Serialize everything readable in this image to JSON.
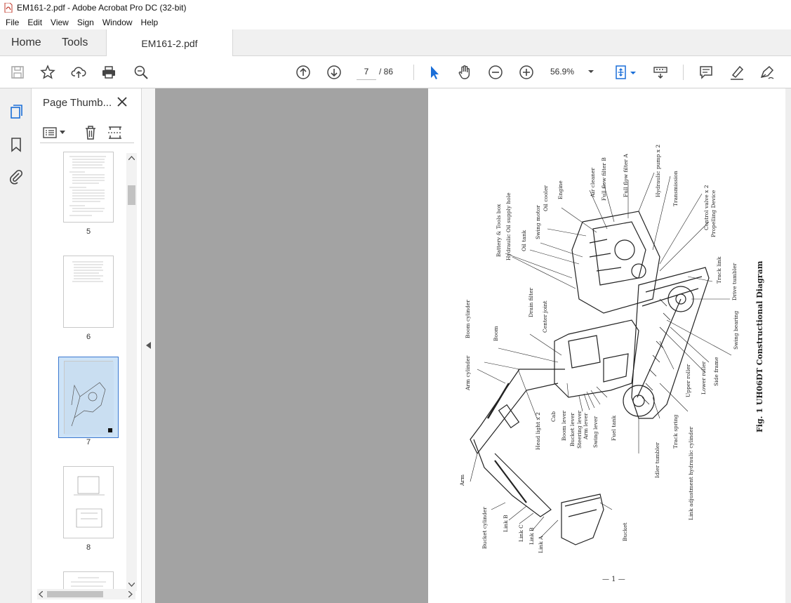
{
  "window": {
    "title": "EM161-2.pdf - Adobe Acrobat Pro DC (32-bit)"
  },
  "menu": [
    "File",
    "Edit",
    "View",
    "Sign",
    "Window",
    "Help"
  ],
  "tabs": {
    "home": "Home",
    "tools": "Tools",
    "document": "EM161-2.pdf"
  },
  "toolbar": {
    "current_page": "7",
    "total_pages": "/ 86",
    "zoom": "56.9%"
  },
  "panel": {
    "title": "Page Thumb...",
    "thumbnails": [
      {
        "label": "5"
      },
      {
        "label": "6"
      },
      {
        "label": "7",
        "selected": true
      },
      {
        "label": "8"
      }
    ]
  },
  "diagram": {
    "caption": "Fig. 1   UH06DT Constructional Diagram",
    "page_number": "— 1 —",
    "labels": [
      "Battery & Tools box",
      "Hydraulic Oil supply hole",
      "Oil tank",
      "Swing motor",
      "Oil cooler",
      "Engine",
      "Air cleaner",
      "Full flow filter B",
      "Full flow filter A",
      "Hydraulic pump x 2",
      "Transmission",
      "Control valve x 2",
      "Propelling Device",
      "Track link",
      "Drive tumbler",
      "Swing bearing",
      "Drain filter",
      "Center joint",
      "Boom cylinder",
      "Boom",
      "Arm cylinder",
      "Cab",
      "Head light x 2",
      "Boom lever",
      "Bucket lever",
      "Steering lever",
      "Arm lever",
      "Swing lever",
      "Fuel tank",
      "Idler tumbler",
      "Track spring",
      "Link adjustment hydraulic cylinder",
      "Upper roller",
      "Lower roller",
      "Side frame",
      "Arm",
      "Bucket cylinder",
      "Link B",
      "Link C",
      "Link B",
      "Link A",
      "Bucket"
    ]
  },
  "icons": {
    "save": "save-icon",
    "star": "star-icon",
    "upload": "upload-icon",
    "print": "print-icon",
    "search": "search-zoom-icon",
    "up": "page-up-icon",
    "down": "page-down-icon",
    "select": "select-arrow-icon",
    "hand": "hand-icon",
    "zoom_out": "zoom-out-icon",
    "zoom_in": "zoom-in-icon"
  }
}
